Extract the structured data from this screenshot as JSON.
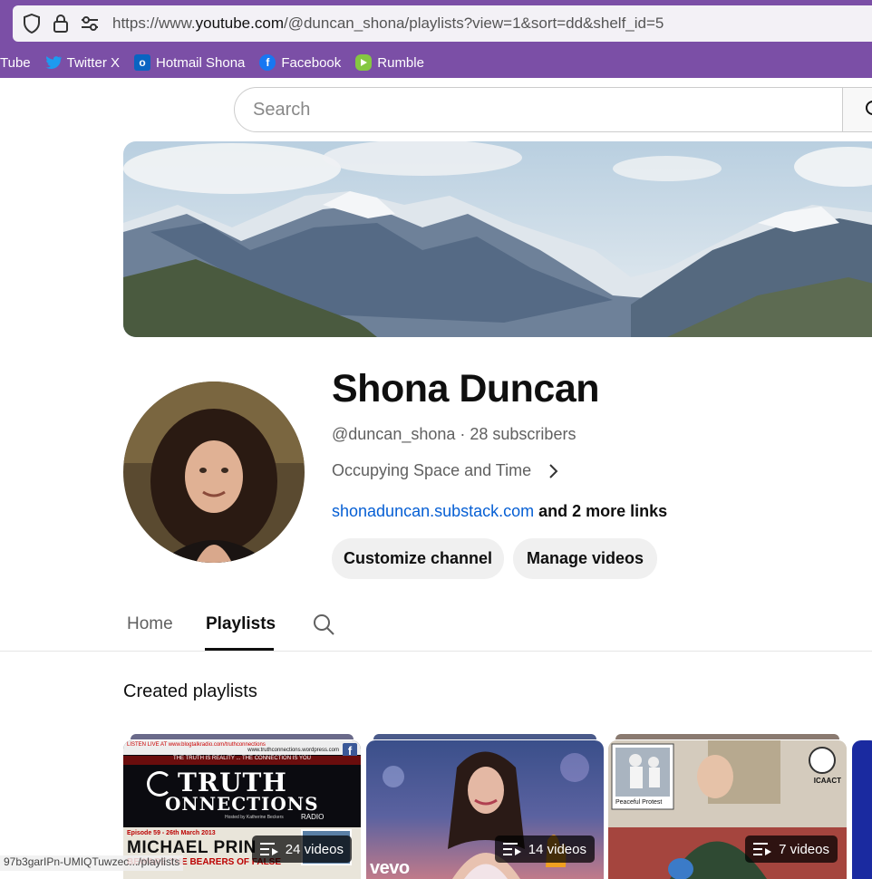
{
  "browser": {
    "url_prefix": "https://www.",
    "url_domain": "youtube.com",
    "url_rest": "/@duncan_shona/playlists?view=1&sort=dd&shelf_id=5",
    "bookmarks": [
      {
        "label": "Tube",
        "icon": "youtube-icon"
      },
      {
        "label": "Twitter X",
        "icon": "twitter-icon"
      },
      {
        "label": "Hotmail Shona",
        "icon": "outlook-icon"
      },
      {
        "label": "Facebook",
        "icon": "facebook-icon"
      },
      {
        "label": "Rumble",
        "icon": "rumble-icon"
      }
    ]
  },
  "search": {
    "placeholder": "Search"
  },
  "channel": {
    "name": "Shona Duncan",
    "handle": "@duncan_shona",
    "separator": " · ",
    "subscribers": "28 subscribers",
    "description": "Occupying Space and Time",
    "link": "shonaduncan.substack.com",
    "more_links": " and 2 more links",
    "customize_label": "Customize channel",
    "manage_label": "Manage videos"
  },
  "tabs": [
    {
      "label": "Home",
      "active": false
    },
    {
      "label": "Playlists",
      "active": true
    }
  ],
  "section": {
    "title": "Created playlists"
  },
  "playlists": [
    {
      "count": "24 videos",
      "thumb": {
        "header": "LISTEN LIVE AT www.blogtalkradio.com/truthconnections",
        "site": "www.truthconnections.wordpress.com",
        "tagline": "THE TRUTH IS REALITY ... THE CONNECTION IS YOU",
        "title1": "TRUTH",
        "title2": "ONNECTIONS",
        "radio": "RADIO",
        "host": "Hosted by Katherine Beckers",
        "episode": "Episode 59 - 26th March 2013",
        "guest": "MICHAEL PRIN",
        "subtitle": "BEWARE THE BEARERS OF FALSE"
      }
    },
    {
      "count": "14 videos",
      "thumb": {
        "brand": "vevo"
      }
    },
    {
      "count": "7 videos",
      "thumb": {
        "caption": "Peaceful Protest",
        "logo": "ICAACT"
      }
    }
  ],
  "status_bar": "97b3garIPn-UMIQTuwzec.../playlists"
}
